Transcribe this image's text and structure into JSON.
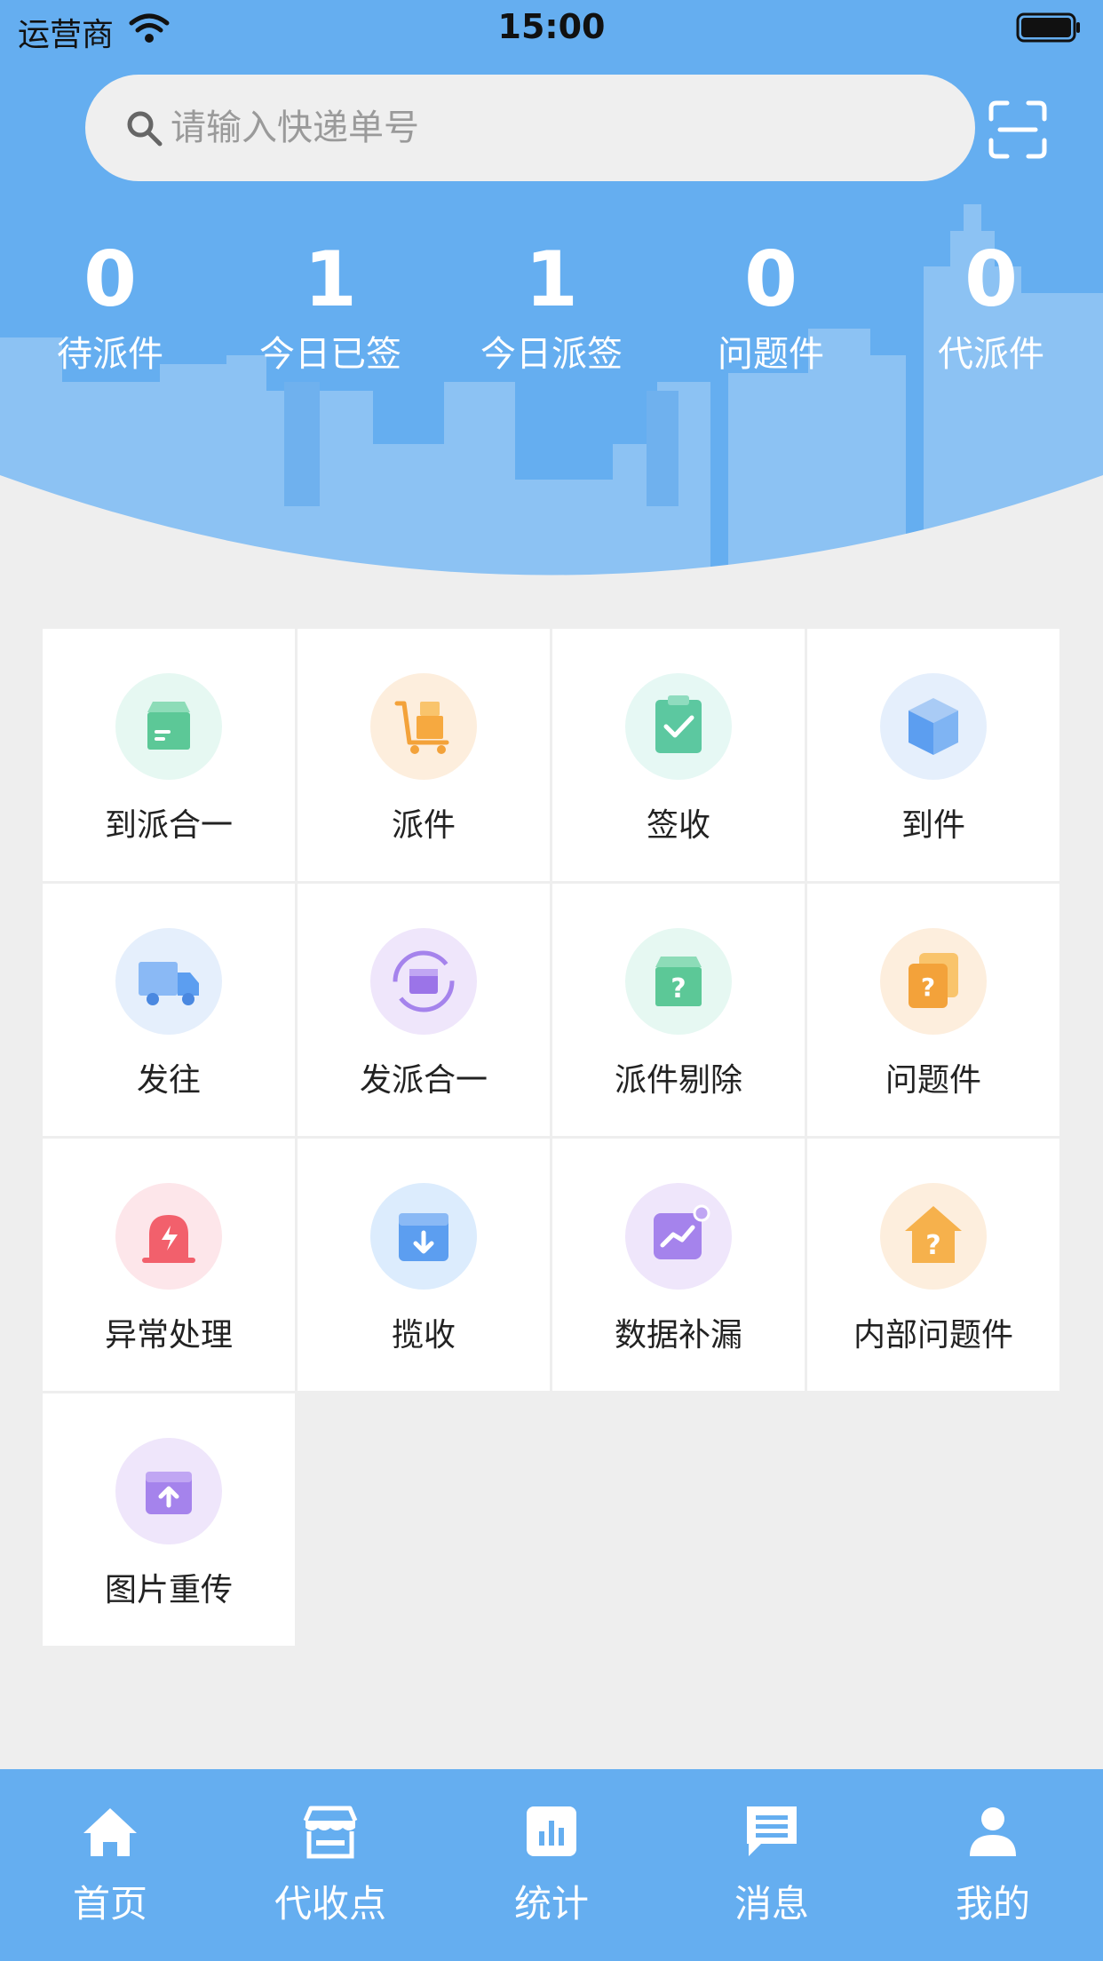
{
  "status_bar": {
    "carrier": "运营商",
    "time": "15:00"
  },
  "search": {
    "placeholder": "请输入快递单号"
  },
  "stats": [
    {
      "value": "0",
      "label": "待派件"
    },
    {
      "value": "1",
      "label": "今日已签"
    },
    {
      "value": "1",
      "label": "今日派签"
    },
    {
      "value": "0",
      "label": "问题件"
    },
    {
      "value": "0",
      "label": "代派件"
    }
  ],
  "grid": [
    {
      "label": "到派合一",
      "icon": "box-icon"
    },
    {
      "label": "派件",
      "icon": "trolley-icon"
    },
    {
      "label": "签收",
      "icon": "clipboard-check-icon"
    },
    {
      "label": "到件",
      "icon": "package-icon"
    },
    {
      "label": "发往",
      "icon": "truck-icon"
    },
    {
      "label": "发派合一",
      "icon": "box-cycle-icon"
    },
    {
      "label": "派件剔除",
      "icon": "box-question-icon"
    },
    {
      "label": "问题件",
      "icon": "question-cards-icon"
    },
    {
      "label": "异常处理",
      "icon": "alarm-icon"
    },
    {
      "label": "揽收",
      "icon": "box-download-icon"
    },
    {
      "label": "数据补漏",
      "icon": "chart-icon"
    },
    {
      "label": "内部问题件",
      "icon": "house-question-icon"
    },
    {
      "label": "图片重传",
      "icon": "upload-box-icon"
    }
  ],
  "tabs": [
    {
      "label": "首页",
      "icon": "home-icon"
    },
    {
      "label": "代收点",
      "icon": "store-icon"
    },
    {
      "label": "统计",
      "icon": "bar-chart-icon"
    },
    {
      "label": "消息",
      "icon": "message-icon"
    },
    {
      "label": "我的",
      "icon": "user-icon"
    }
  ],
  "colors": {
    "primary": "#65aef0",
    "background": "#eeeeee",
    "skyline": "#8cc4f4"
  }
}
